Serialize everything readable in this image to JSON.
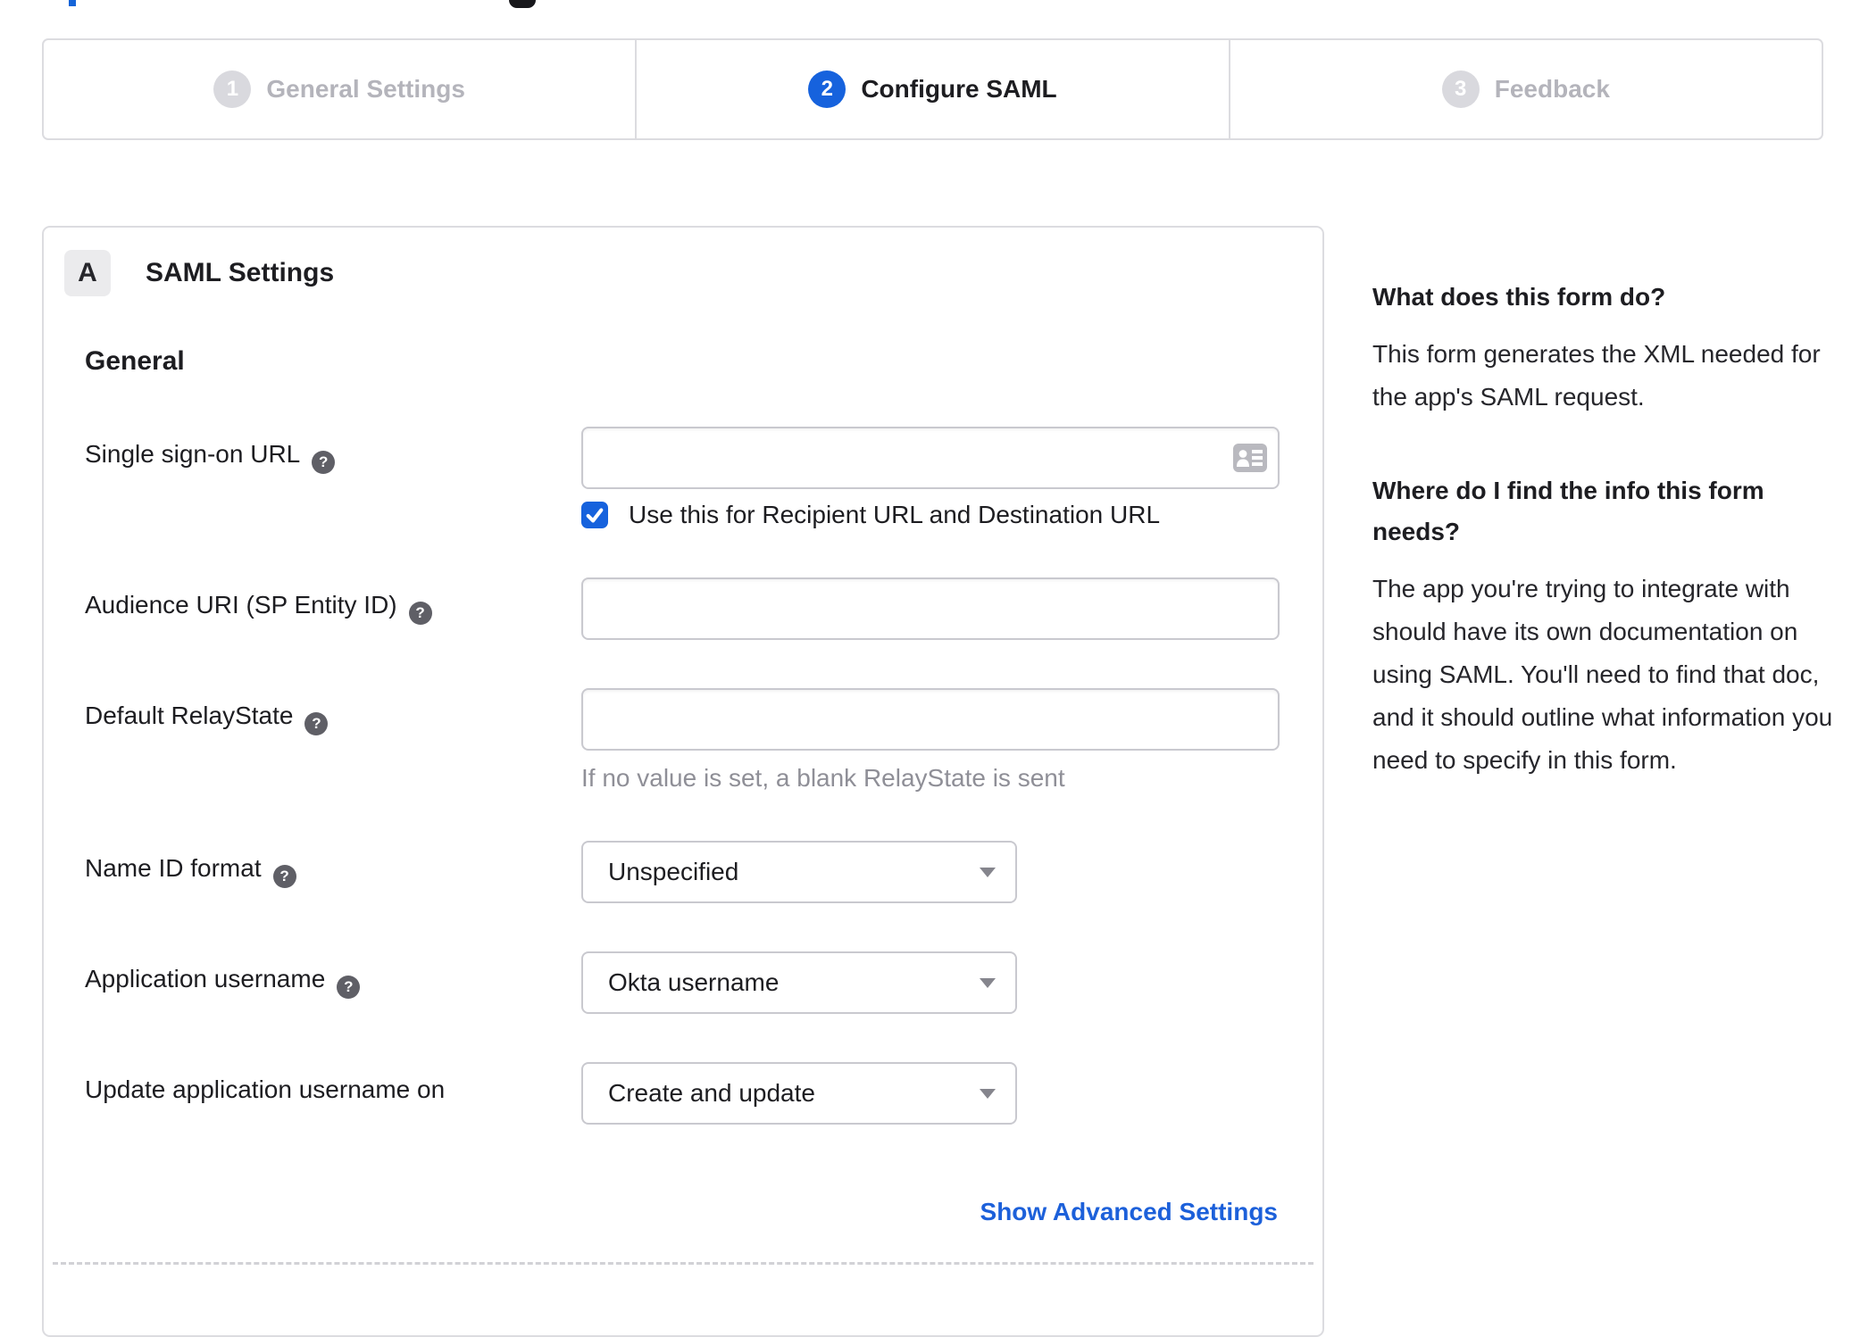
{
  "colors": {
    "accent_blue": "#1662dd",
    "link_blue": "#1c60da",
    "text_dark": "#1d1d21",
    "muted_gray": "#8f8f97",
    "border_gray": "#dcdce0",
    "inactive_step_gray": "#d9d9de"
  },
  "icons": {
    "help_glyph": "?"
  },
  "stepper": {
    "steps": [
      {
        "number": "1",
        "label": "General Settings",
        "state": "inactive"
      },
      {
        "number": "2",
        "label": "Configure SAML",
        "state": "active"
      },
      {
        "number": "3",
        "label": "Feedback",
        "state": "inactive"
      }
    ]
  },
  "panel": {
    "badge": "A",
    "title": "SAML Settings",
    "section": "General",
    "fields": {
      "sso_url": {
        "label": "Single sign-on URL",
        "value": "",
        "checkbox_label": "Use this for Recipient URL and Destination URL",
        "checkbox_checked": true
      },
      "audience_uri": {
        "label": "Audience URI (SP Entity ID)",
        "value": ""
      },
      "relay_state": {
        "label": "Default RelayState",
        "value": "",
        "hint": "If no value is set, a blank RelayState is sent"
      },
      "name_id_format": {
        "label": "Name ID format",
        "value": "Unspecified"
      },
      "app_username": {
        "label": "Application username",
        "value": "Okta username"
      },
      "update_username": {
        "label": "Update application username on",
        "value": "Create and update"
      }
    },
    "advanced_link": "Show Advanced Settings"
  },
  "sidebar": {
    "sections": [
      {
        "heading": "What does this form do?",
        "body": "This form generates the XML needed for the app's SAML request."
      },
      {
        "heading": "Where do I find the info this form needs?",
        "body": "The app you're trying to integrate with should have its own documentation on using SAML. You'll need to find that doc, and it should outline what information you need to specify in this form."
      }
    ]
  }
}
